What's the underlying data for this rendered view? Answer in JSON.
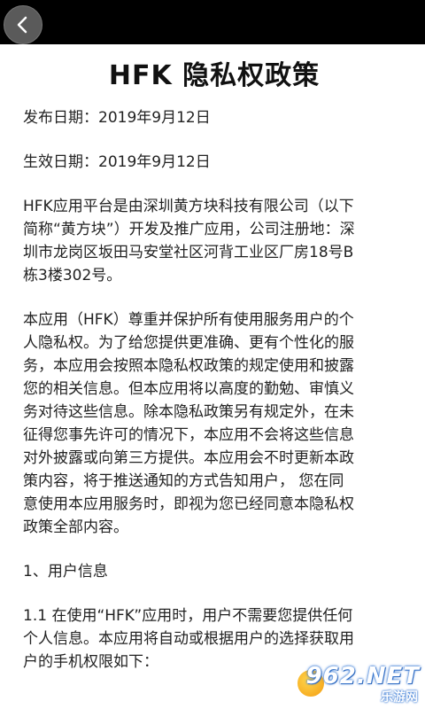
{
  "header": {
    "back_icon": "chevron-left-icon",
    "bar_color": "#000000"
  },
  "doc": {
    "title": "HFK 隐私权政策",
    "publish_date": "发布日期：2019年9月12日",
    "effective_date": "生效日期：2019年9月12日",
    "intro_lines": [
      "HFK应用平台是由深圳黄方块科技有限公司（以下",
      "简称“黄方块”）开发及推广应用，公司注册地：深",
      "圳市龙岗区坂田马安堂社区河背工业区厂房18号B",
      "栋3楼302号。"
    ],
    "policy_lines": [
      "本应用（HFK）尊重并保护所有使用服务用户的个",
      "人隐私权。为了给您提供更准确、更有个性化的服",
      "务，本应用会按照本隐私权政策的规定使用和披露",
      "您的相关信息。但本应用将以高度的勤勉、审慎义",
      "务对待这些信息。除本隐私政策另有规定外，在未",
      "征得您事先许可的情况下，本应用不会将这些信息",
      "对外披露或向第三方提供。本应用会不时更新本政",
      "策内容，将于推送通知的方式告知用户，  您在同",
      "意使用本应用服务时，即视为您已经同意本隐私权",
      "政策全部内容。"
    ],
    "section1_heading": "1、用户信息",
    "section1_1_lines": [
      "1.1 在使用“HFK”应用时，用户不需要您提供任何",
      "个人信息。本应用将自动或根据用户的选择获取用",
      "户的手机权限如下："
    ]
  },
  "watermark": {
    "main": "962.NET",
    "sub": "乐游网"
  }
}
